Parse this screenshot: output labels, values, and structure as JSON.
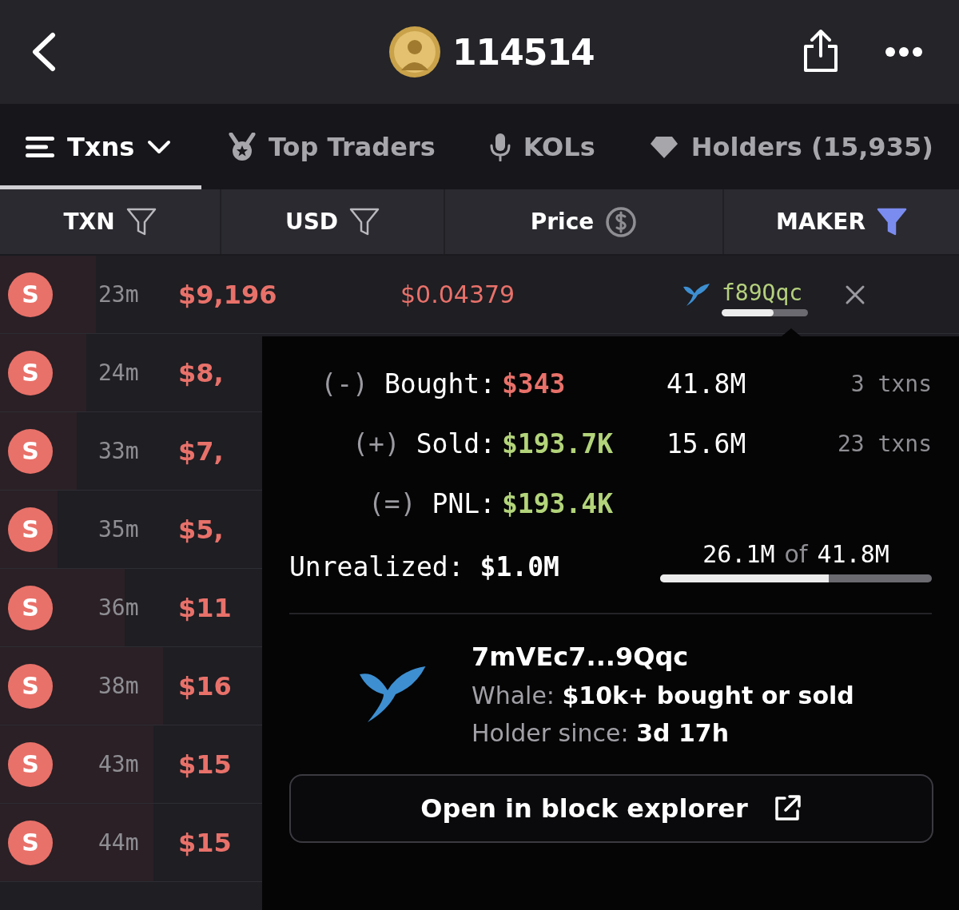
{
  "header": {
    "title": "114514"
  },
  "tabs": [
    {
      "label": "Txns",
      "selected": true
    },
    {
      "label": "Top Traders",
      "selected": false
    },
    {
      "label": "KOLs",
      "selected": false
    },
    {
      "label": "Holders (15,935)",
      "selected": false
    }
  ],
  "columns": [
    {
      "label": "TXN",
      "active": false
    },
    {
      "label": "USD",
      "active": false
    },
    {
      "label": "Price",
      "active": false
    },
    {
      "label": "MAKER",
      "active": true
    }
  ],
  "rows": [
    {
      "kind": "sell",
      "badge": "S",
      "time": "23m",
      "usd": "$9,196",
      "price": "$0.04379",
      "maker": {
        "address": "f89Qqc",
        "level": 0.6
      },
      "level": 0.1
    },
    {
      "kind": "sell",
      "badge": "S",
      "time": "24m",
      "usd": "$8,",
      "level": 0.09
    },
    {
      "kind": "sell",
      "badge": "S",
      "time": "33m",
      "usd": "$7,",
      "level": 0.08
    },
    {
      "kind": "sell",
      "badge": "S",
      "time": "35m",
      "usd": "$5,",
      "level": 0.06
    },
    {
      "kind": "sell",
      "badge": "S",
      "time": "36m",
      "usd": "$11",
      "level": 0.13
    },
    {
      "kind": "sell",
      "badge": "S",
      "time": "38m",
      "usd": "$16",
      "level": 0.17
    },
    {
      "kind": "sell",
      "badge": "S",
      "time": "43m",
      "usd": "$15",
      "level": 0.16
    },
    {
      "kind": "sell",
      "badge": "S",
      "time": "44m",
      "usd": "$15",
      "level": 0.16
    }
  ],
  "popover": {
    "stats": [
      {
        "sign": "(-)",
        "label": "Bought:",
        "value": "$343",
        "color": "#e8716a",
        "amount": "41.8M",
        "txns": "3 txns"
      },
      {
        "sign": "(+)",
        "label": "Sold:",
        "value": "$193.7K",
        "color": "#b3d47a",
        "amount": "15.6M",
        "txns": "23 txns"
      },
      {
        "sign": "(=)",
        "label": "PNL:",
        "value": "$193.4K",
        "color": "#b3d47a"
      }
    ],
    "unrealized": {
      "label": "Unrealized:",
      "value": "$1.0M",
      "held": "26.1M",
      "of": "of",
      "total": "41.8M",
      "level": 0.62
    },
    "wallet": {
      "address": "7mVEc7...9Qqc",
      "type": "Whale: **$10k+ bought or sold**",
      "since": "Holder since: **3d 17h**"
    },
    "button": "Open in block explorer"
  }
}
